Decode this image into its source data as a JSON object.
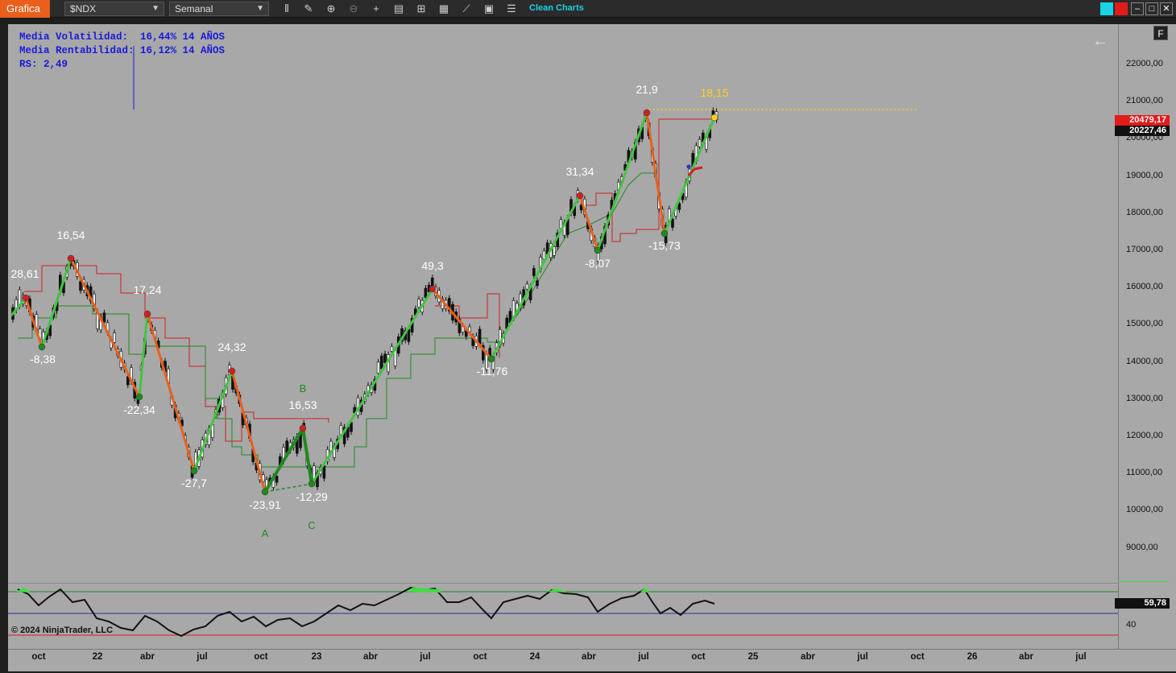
{
  "toolbar": {
    "window_title": "Grafica",
    "symbol": "$NDX",
    "timeframe": "Semanal",
    "clean_charts": "Clean Charts",
    "icons": [
      "bar-chart-icon",
      "pencil-icon",
      "zoom-in-icon",
      "zoom-out-icon",
      "crosshair-icon",
      "properties-icon",
      "templates-icon",
      "strategies-icon",
      "indicators-icon",
      "share-icon",
      "list-icon"
    ]
  },
  "stats": {
    "line1": "Media Volatilidad:  16,44% 14 AÑOS",
    "line2": "Media Rentabilidad: 16,12% 14 AÑOS",
    "line3": "RS: 2,49"
  },
  "price_axis": [
    "22000,00",
    "21000,00",
    "20000,00",
    "19000,00",
    "18000,00",
    "17000,00",
    "16000,00",
    "15000,00",
    "14000,00",
    "13000,00",
    "12000,00",
    "11000,00",
    "10000,00",
    "9000,00"
  ],
  "price_tags": {
    "high_tag": "20479,17",
    "last_price": "20227,46"
  },
  "indicator": {
    "value": "59,78",
    "level": "40"
  },
  "time_axis": [
    "oct",
    "22",
    "abr",
    "jul",
    "oct",
    "23",
    "abr",
    "jul",
    "oct",
    "24",
    "abr",
    "jul",
    "oct",
    "25",
    "abr",
    "jul",
    "oct",
    "26",
    "abr",
    "jul"
  ],
  "copyright": "© 2024 NinjaTrader, LLC",
  "fbutton": "F",
  "swing_labels": [
    "28,61",
    "-8,38",
    "16,54",
    "-22,34",
    "17,24",
    "-27,7",
    "24,32",
    "-23,91",
    "16,53",
    "-12,29",
    "49,3",
    "-11,76",
    "31,34",
    "-8,07",
    "21,9",
    "-15,73",
    "18,15"
  ],
  "wave_labels": [
    "A",
    "B",
    "C"
  ],
  "colors": {
    "up_leg": "#43c443",
    "down_leg": "#e8601c",
    "wave": "#1f8a1f",
    "stats": "#1a1ad8",
    "highlight": "#ffd21a",
    "tag_red": "#e21b1b"
  }
}
